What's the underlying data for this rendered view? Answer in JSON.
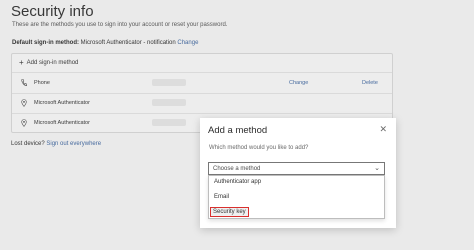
{
  "page": {
    "title": "Security info",
    "subtitle": "These are the methods you use to sign into your account or reset your password.",
    "default_label": "Default sign-in method:",
    "default_value": "Microsoft Authenticator - notification",
    "default_change": "Change",
    "add_method": "Add sign-in method",
    "methods": [
      {
        "name": "Phone",
        "change": "Change",
        "delete": "Delete",
        "icon": "phone-icon"
      },
      {
        "name": "Microsoft Authenticator",
        "icon": "authenticator-icon"
      },
      {
        "name": "Microsoft Authenticator",
        "icon": "authenticator-icon"
      }
    ],
    "lost_label": "Lost device?",
    "lost_link": "Sign out everywhere"
  },
  "dialog": {
    "title": "Add a method",
    "close": "✕",
    "question": "Which method would you like to add?",
    "select_value": "Choose a method",
    "options": [
      "Authenticator app",
      "Email",
      "Security key"
    ],
    "highlight_color": "#d9302e"
  }
}
